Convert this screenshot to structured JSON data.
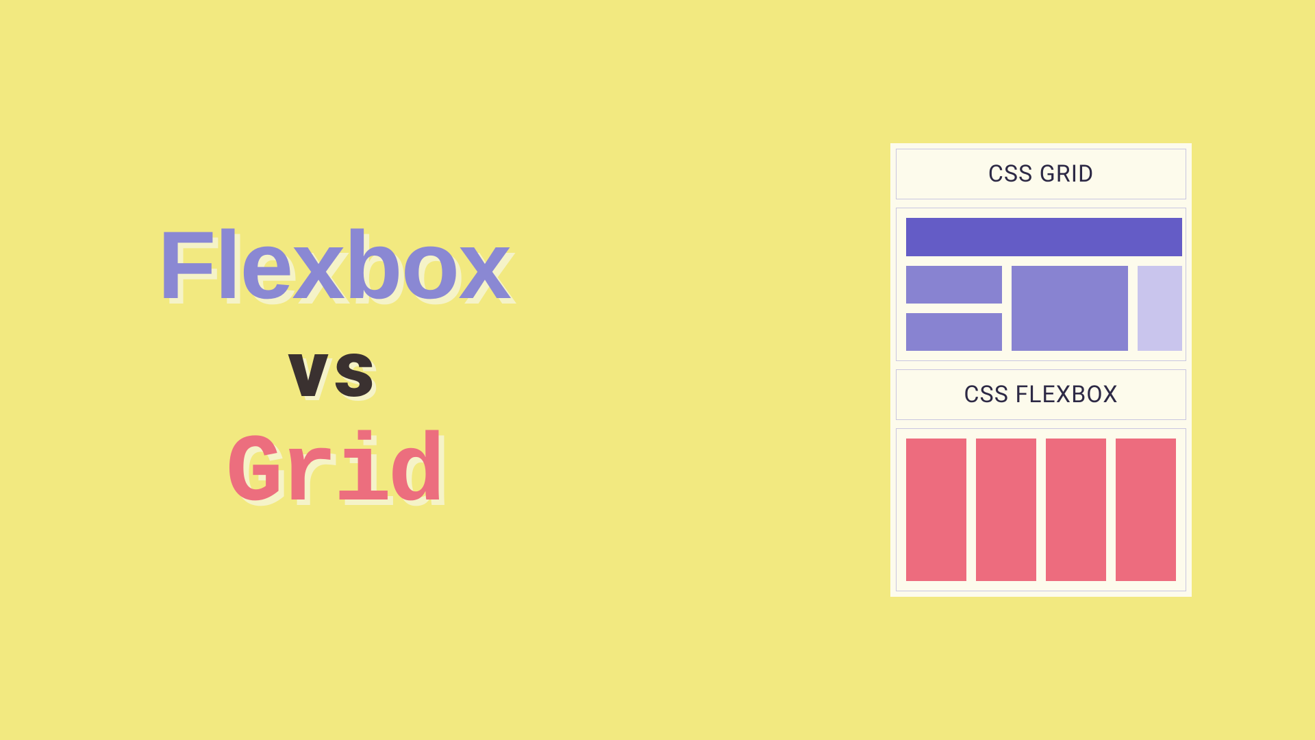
{
  "title": {
    "line1": "Flexbox",
    "line2": "vs",
    "line3": "Grid"
  },
  "diagram": {
    "grid_label": "CSS GRID",
    "flexbox_label": "CSS FLEXBOX"
  },
  "colors": {
    "background": "#f2e980",
    "flexbox_text": "#8a88d3",
    "vs_text": "#3a3130",
    "grid_text": "#ec6e7e",
    "shadow": "#f5f3c8",
    "panel_bg": "#fdfbec",
    "grid_primary": "#645cc6",
    "grid_secondary": "#8883d1",
    "grid_tertiary": "#c9c5ed",
    "flex_block": "#ed6c7e"
  }
}
